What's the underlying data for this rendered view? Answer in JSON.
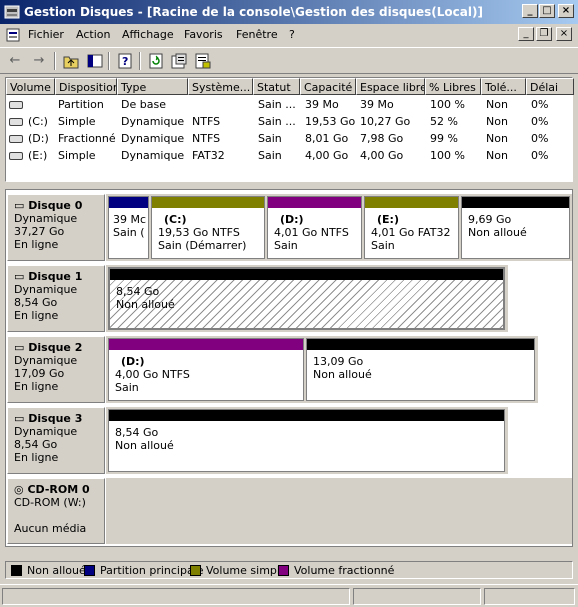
{
  "window": {
    "title": "Gestion Disques - [Racine de la console\\Gestion des disques(Local)]"
  },
  "menu": {
    "items": [
      "Fichier",
      "Action",
      "Affichage",
      "Favoris",
      "Fenêtre",
      "?"
    ]
  },
  "columns": [
    "Volume",
    "Disposition",
    "Type",
    "Système...",
    "Statut",
    "Capacité",
    "Espace libre",
    "% Libres",
    "Tolé...",
    "Délai"
  ],
  "volumes": [
    [
      "",
      "Partition",
      "De base",
      "",
      "Sain ...",
      "39 Mo",
      "39 Mo",
      "100 %",
      "Non",
      "0%"
    ],
    [
      "(C:)",
      "Simple",
      "Dynamique",
      "NTFS",
      "Sain ...",
      "19,53 Go",
      "10,27 Go",
      "52 %",
      "Non",
      "0%"
    ],
    [
      "(D:)",
      "Fractionné",
      "Dynamique",
      "NTFS",
      "Sain",
      "8,01 Go",
      "7,98 Go",
      "99 %",
      "Non",
      "0%"
    ],
    [
      "(E:)",
      "Simple",
      "Dynamique",
      "FAT32",
      "Sain",
      "4,00 Go",
      "4,00 Go",
      "100 %",
      "Non",
      "0%"
    ]
  ],
  "disks": [
    {
      "name": "Disque 0",
      "type": "Dynamique",
      "size": "37,27 Go",
      "status": "En ligne",
      "parts": [
        {
          "name": "",
          "l1": "39 Mc",
          "l2": "Sain (",
          "color": "#000080"
        },
        {
          "name": "(C:)",
          "l1": "19,53 Go NTFS",
          "l2": "Sain (Démarrer)",
          "color": "#808000"
        },
        {
          "name": "(D:)",
          "l1": "4,01 Go NTFS",
          "l2": "Sain",
          "color": "#800080"
        },
        {
          "name": "(E:)",
          "l1": "4,01 Go FAT32",
          "l2": "Sain",
          "color": "#808000"
        },
        {
          "name": "",
          "l1": "9,69 Go",
          "l2": "Non alloué",
          "color": "#000000"
        }
      ]
    },
    {
      "name": "Disque 1",
      "type": "Dynamique",
      "size": "8,54 Go",
      "status": "En ligne",
      "parts": [
        {
          "name": "",
          "l1": "8,54 Go",
          "l2": "Non alloué",
          "color": "#000000"
        }
      ]
    },
    {
      "name": "Disque 2",
      "type": "Dynamique",
      "size": "17,09 Go",
      "status": "En ligne",
      "parts": [
        {
          "name": "(D:)",
          "l1": "4,00 Go NTFS",
          "l2": "Sain",
          "color": "#800080"
        },
        {
          "name": "",
          "l1": "13,09 Go",
          "l2": "Non alloué",
          "color": "#000000"
        }
      ]
    },
    {
      "name": "Disque 3",
      "type": "Dynamique",
      "size": "8,54 Go",
      "status": "En ligne",
      "parts": [
        {
          "name": "",
          "l1": "8,54 Go",
          "l2": "Non alloué",
          "color": "#000000"
        }
      ]
    }
  ],
  "cdrom": {
    "name": "CD-ROM 0",
    "drive": "CD-ROM (W:)",
    "status": "Aucun média"
  },
  "legend": [
    {
      "label": "Non alloué",
      "color": "#000000"
    },
    {
      "label": "Partition principale",
      "color": "#000080"
    },
    {
      "label": "Volume simple",
      "color": "#808000"
    },
    {
      "label": "Volume fractionné",
      "color": "#800080"
    }
  ],
  "icons": {
    "back": "back-arrow-icon",
    "forward": "forward-arrow-icon",
    "up": "up-folder-icon",
    "showhide": "console-tree-icon",
    "help": "help-icon",
    "refresh": "refresh-icon",
    "properties": "properties-icon",
    "export": "export-icon"
  }
}
